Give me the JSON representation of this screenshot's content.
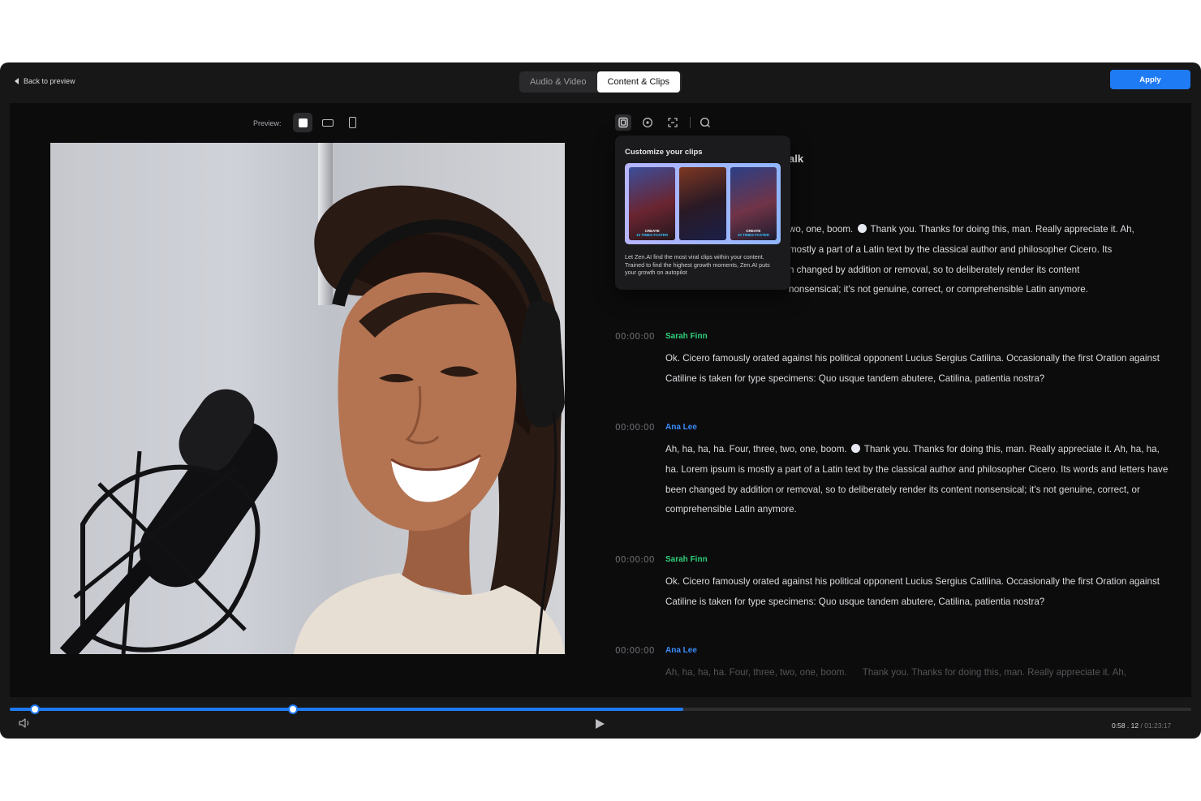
{
  "header": {
    "back_label": "Back to preview",
    "tabs": [
      {
        "label": "Audio & Video",
        "active": false
      },
      {
        "label": "Content & Clips",
        "active": true
      }
    ],
    "apply_label": "Apply"
  },
  "preview": {
    "label": "Preview:",
    "ratios": [
      {
        "icon": "square-ratio-icon",
        "active": true
      },
      {
        "icon": "landscape-ratio-icon",
        "active": false
      },
      {
        "icon": "portrait-ratio-icon",
        "active": false
      }
    ]
  },
  "transcript_toolbar": {
    "tools": [
      "clips-icon",
      "chat-icon",
      "crop-icon",
      "search-icon"
    ],
    "active": "clips-icon"
  },
  "popover": {
    "title": "Customize your clips",
    "thumb_tag_1": "CREATE",
    "thumb_tag_1_hi": "10 TIMES FASTER",
    "thumb_tag_3": "CREATE",
    "thumb_tag_3_hi": "10 TIMES FASTER",
    "description": "Let Zen.AI find the most viral clips within your content. Trained to find the highest growth moments, Zen.AI puts your growth on autopilot"
  },
  "transcript": {
    "title_fragment": "alk",
    "first_block": {
      "line1_a": "wo, one, boom.",
      "line1_b": "Thank you. Thanks for doing this, man. Really appreciate it. Ah,",
      "line2": "mostly a part of a Latin text by the classical author and philosopher Cicero. Its",
      "line3": "n changed by addition or removal, so to deliberately render its content",
      "line4": "nonsensical; it's not genuine, correct, or comprehensible Latin anymore."
    },
    "entries": [
      {
        "time": "00:00:00",
        "speaker": "Sarah Finn",
        "text": "Ok. Cicero famously orated against his political opponent Lucius Sergius Catilina. Occasionally the first Oration against Catiline is taken for type specimens: Quo usque tandem abutere, Catilina, patientia nostra?"
      },
      {
        "time": "00:00:00",
        "speaker": "Ana Lee",
        "text_a": "Ah, ha, ha, ha. Four, three, two, one, boom.",
        "text_b": "Thank you. Thanks for doing this, man. Really appreciate it. Ah, ha, ha, ha. Lorem ipsum is mostly a part of a Latin text by the classical author and philosopher Cicero. Its words and letters have been changed by addition or removal, so to deliberately render its content nonsensical; it's not genuine, correct, or comprehensible Latin anymore."
      },
      {
        "time": "00:00:00",
        "speaker": "Sarah Finn",
        "text": "Ok. Cicero famously orated against his political opponent Lucius Sergius Catilina. Occasionally the first Oration against Catiline is taken for type specimens: Quo usque tandem abutere, Catilina, patientia nostra?"
      },
      {
        "time": "00:00:00",
        "speaker": "Ana Lee",
        "text": "Ah, ha, ha, ha. Four, three, two, one, boom.      Thank you. Thanks for doing this, man. Really appreciate it. Ah,"
      }
    ]
  },
  "player": {
    "current_time": "0:58 . 12",
    "duration": "/ 01:23:17",
    "progress_fraction": 0.57
  },
  "colors": {
    "accent": "#1f7bf4",
    "speaker_green": "#2fd07a",
    "speaker_blue": "#3a8dfa",
    "background": "#0c0c0d"
  }
}
